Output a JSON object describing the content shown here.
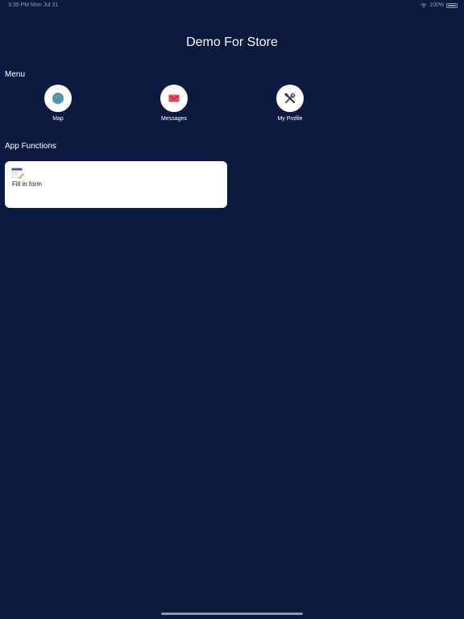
{
  "status_bar": {
    "time_date": "3:35 PM  Mon Jul 31",
    "battery": "100%"
  },
  "page": {
    "title": "Demo For Store"
  },
  "menu": {
    "label": "Menu",
    "items": [
      {
        "label": "Map",
        "icon": "globe-icon"
      },
      {
        "label": "Messages",
        "icon": "envelope-icon"
      },
      {
        "label": "My Profile",
        "icon": "tools-icon"
      }
    ]
  },
  "app_functions": {
    "label": "App Functions",
    "items": [
      {
        "label": "Fill in form",
        "icon": "form-pencil-icon"
      }
    ]
  },
  "colors": {
    "background": "#0c1a42",
    "card": "#ffffff",
    "text": "#ffffff"
  }
}
